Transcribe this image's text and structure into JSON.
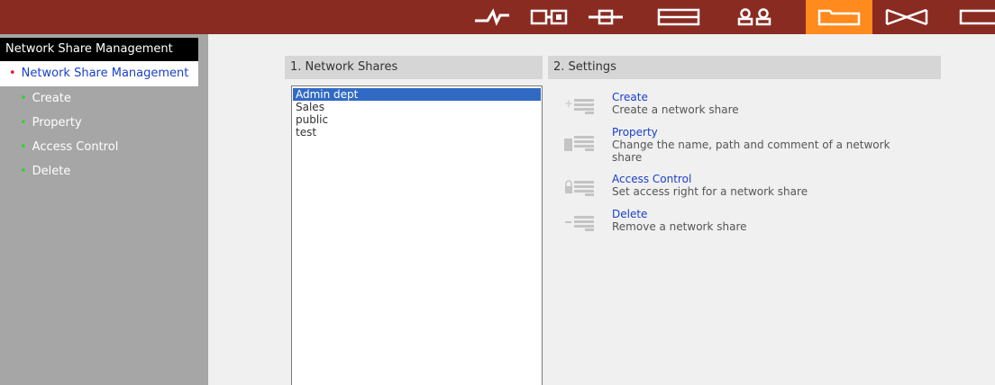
{
  "topbar": {
    "icons": [
      {
        "name": "network-icon",
        "active": false
      },
      {
        "name": "ports-icon",
        "active": false
      },
      {
        "name": "connections-icon",
        "active": false
      },
      {
        "name": "storage-icon",
        "active": false
      },
      {
        "name": "users-icon",
        "active": false
      },
      {
        "name": "network-share-folder-icon",
        "active": true
      },
      {
        "name": "mail-icon",
        "active": false
      },
      {
        "name": "more-icon",
        "active": false
      }
    ],
    "colors": {
      "bar": "#8a2b22",
      "active": "#ff8a1e"
    }
  },
  "sidebar": {
    "title": "Network Share Management",
    "main_item": "Network Share Management",
    "sub_items": [
      {
        "label": "Create"
      },
      {
        "label": "Property"
      },
      {
        "label": "Access Control"
      },
      {
        "label": "Delete"
      }
    ]
  },
  "shares": {
    "header": "1. Network Shares",
    "items": [
      "Admin dept",
      "Sales",
      "public",
      "test"
    ],
    "selected": "Admin dept"
  },
  "settings": {
    "header": "2. Settings",
    "items": [
      {
        "icon": "create-share-icon",
        "title": "Create",
        "desc": "Create a network share"
      },
      {
        "icon": "property-share-icon",
        "title": "Property",
        "desc": "Change the name, path and comment of a network share"
      },
      {
        "icon": "access-control-share-icon",
        "title": "Access Control",
        "desc": "Set access right for a network share"
      },
      {
        "icon": "delete-share-icon",
        "title": "Delete",
        "desc": "Remove a network share"
      }
    ]
  }
}
